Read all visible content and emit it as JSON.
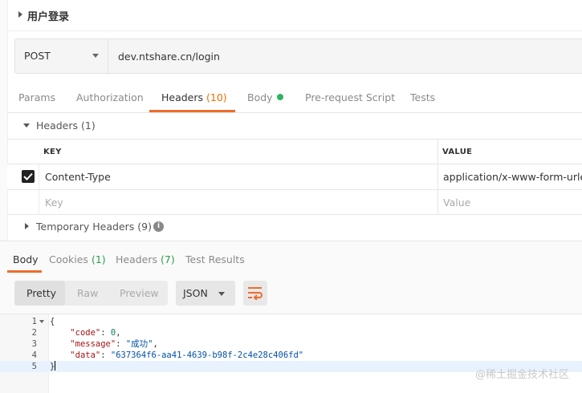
{
  "request": {
    "title": "用户登录",
    "method": "POST",
    "url": "dev.ntshare.cn/login"
  },
  "request_tabs": [
    {
      "label": "Params"
    },
    {
      "label": "Authorization"
    },
    {
      "label": "Headers",
      "count": "(10)"
    },
    {
      "label": "Body"
    },
    {
      "label": "Pre-request Script"
    },
    {
      "label": "Tests"
    }
  ],
  "headers_section": {
    "label": "Headers (1)",
    "col_key": "KEY",
    "col_value": "VALUE",
    "rows": [
      {
        "key": "Content-Type",
        "value": "application/x-www-form-urlencoded",
        "checked": true
      }
    ],
    "placeholder_key": "Key",
    "placeholder_value": "Value"
  },
  "temp_headers": {
    "label": "Temporary Headers (9)",
    "info_icon_glyph": "i"
  },
  "response_tabs": [
    {
      "label": "Body"
    },
    {
      "label": "Cookies",
      "count": "(1)"
    },
    {
      "label": "Headers",
      "count": "(7)"
    },
    {
      "label": "Test Results"
    }
  ],
  "response_toolbar": {
    "formats": [
      "Pretty",
      "Raw",
      "Preview"
    ],
    "language": "JSON"
  },
  "response_body": {
    "line_numbers": [
      "1",
      "2",
      "3",
      "4",
      "5"
    ],
    "open_brace": "{",
    "close_brace": "}",
    "fields": [
      {
        "key": "\"code\"",
        "value": "0",
        "sep": ": ",
        "trail": ","
      },
      {
        "key": "\"message\"",
        "value": "\"成功\"",
        "sep": ": ",
        "trail": ","
      },
      {
        "key": "\"data\"",
        "value": "\"637364f6-aa41-4639-b98f-2c4e28c406fd\"",
        "sep": ": ",
        "trail": ""
      }
    ]
  },
  "watermark": "@稀土掘金技术社区",
  "colors": {
    "accent": "#ef6c2a",
    "dot_green": "#2eb362"
  }
}
